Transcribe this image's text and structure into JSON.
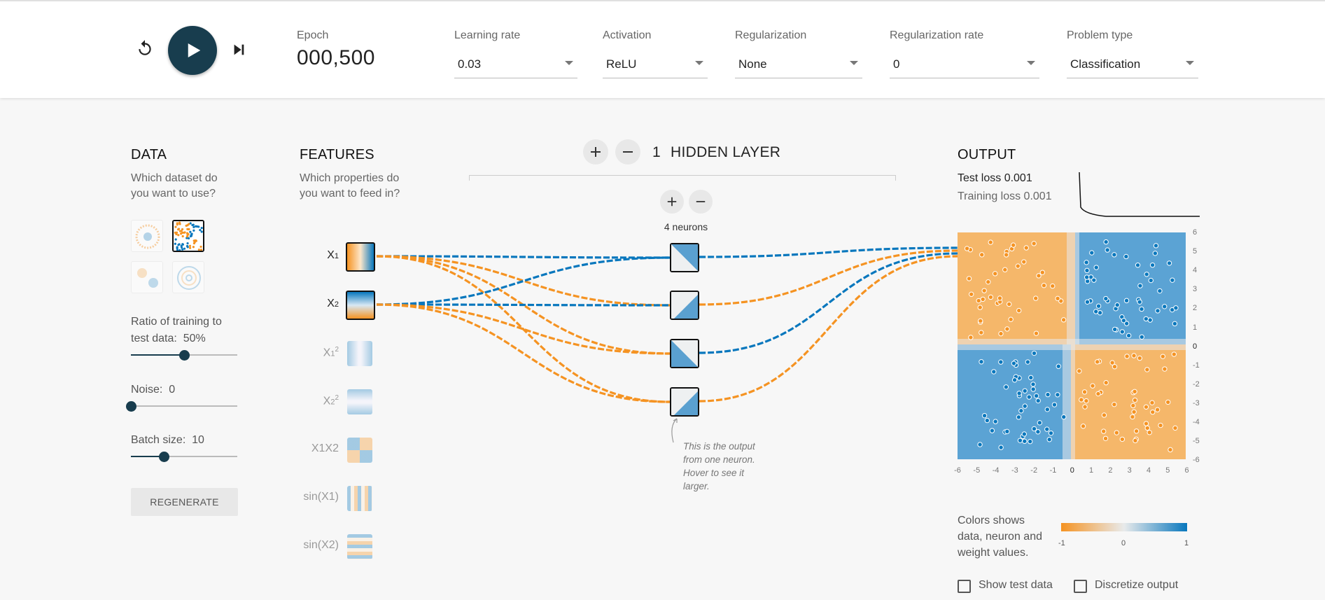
{
  "colors": {
    "orange": "#f59322",
    "blue": "#0877bd",
    "dark": "#183d4e",
    "neutral": "#e8eaeb"
  },
  "toolbar": {
    "epoch_label": "Epoch",
    "epoch_value": "000,500",
    "learning_rate_label": "Learning rate",
    "learning_rate_value": "0.03",
    "activation_label": "Activation",
    "activation_value": "ReLU",
    "regularization_label": "Regularization",
    "regularization_value": "None",
    "regularization_rate_label": "Regularization rate",
    "regularization_rate_value": "0",
    "problem_type_label": "Problem type",
    "problem_type_value": "Classification",
    "icons": {
      "reset": "reset-icon",
      "play": "play-icon",
      "step": "step-forward-icon"
    }
  },
  "data_panel": {
    "title": "DATA",
    "subtitle": "Which dataset do you want to use?",
    "datasets": [
      {
        "name": "circle",
        "selected": false
      },
      {
        "name": "xor",
        "selected": true
      },
      {
        "name": "gaussian",
        "selected": false
      },
      {
        "name": "spiral",
        "selected": false
      }
    ],
    "ratio_label": "Ratio of training to test data:",
    "ratio_value": "50%",
    "ratio_fraction": 0.5,
    "noise_label": "Noise:",
    "noise_value": "0",
    "noise_fraction": 0.0,
    "batch_label": "Batch size:",
    "batch_value": "10",
    "batch_fraction": 0.31,
    "regenerate_label": "REGENERATE"
  },
  "features_panel": {
    "title": "FEATURES",
    "subtitle": "Which properties do you want to feed in?",
    "features": [
      {
        "id": "x1",
        "label": "X1",
        "base": "X",
        "sub": "1",
        "sup": "",
        "active": true
      },
      {
        "id": "x2",
        "label": "X2",
        "base": "X",
        "sub": "2",
        "sup": "",
        "active": true
      },
      {
        "id": "x1sq",
        "label": "X12",
        "base": "X",
        "sub": "1",
        "sup": "2",
        "active": false
      },
      {
        "id": "x2sq",
        "label": "X22",
        "base": "X",
        "sub": "2",
        "sup": "2",
        "active": false
      },
      {
        "id": "x1x2",
        "label": "X1X2",
        "base": "X1X2",
        "sub": "",
        "sup": "",
        "active": false
      },
      {
        "id": "sinx1",
        "label": "sin(X1)",
        "base": "sin(X1)",
        "sub": "",
        "sup": "",
        "active": false
      },
      {
        "id": "sinx2",
        "label": "sin(X2)",
        "base": "sin(X2)",
        "sub": "",
        "sup": "",
        "active": false
      }
    ]
  },
  "network": {
    "layer_count": "1",
    "layer_label": "HIDDEN LAYER",
    "neurons_label": "4 neurons",
    "tip_text": "This is the output from one neuron. Hover to see it larger.",
    "neurons": 4
  },
  "output_panel": {
    "title": "OUTPUT",
    "test_loss": "Test loss 0.001",
    "training_loss": "Training loss 0.001",
    "y_ticks": [
      "6",
      "5",
      "4",
      "3",
      "2",
      "1",
      "0",
      "-1",
      "-2",
      "-3",
      "-4",
      "-5",
      "-6"
    ],
    "x_ticks": [
      "-6",
      "-5",
      "-4",
      "-3",
      "-2",
      "-1",
      "0",
      "1",
      "2",
      "3",
      "4",
      "5",
      "6"
    ],
    "legend_text": "Colors shows data, neuron and weight values.",
    "legend_min": "-1",
    "legend_mid": "0",
    "legend_max": "1",
    "show_test_label": "Show test data",
    "discretize_label": "Discretize output"
  }
}
